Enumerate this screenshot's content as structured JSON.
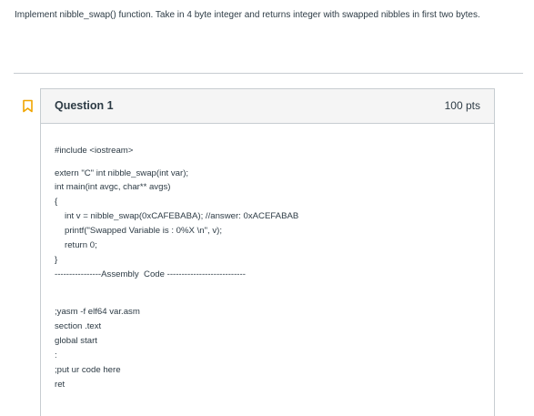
{
  "instructions": "Implement nibble_swap() function. Take in 4 byte integer and returns integer with swapped nibbles in first two bytes.",
  "colors": {
    "flag_accent": "#f0a500",
    "header_bg": "#f5f5f5",
    "border": "#c7cdd1",
    "text": "#2d3b45"
  },
  "question": {
    "title": "Question 1",
    "points": "100 pts",
    "flag_icon": "bookmark-flag-icon",
    "code_lines": [
      "#include <iostream>",
      "extern \"C\" int nibble_swap(int var);",
      "int main(int avgc, char** avgs)",
      "{",
      "int v = nibble_swap(0xCAFEBABA); //answer: 0xACEFABAB",
      "printf(\"Swapped Variable is : 0%X \\n\", v);",
      "return 0;",
      "}",
      "----------------Assembly  Code ---------------------------",
      ";yasm -f elf64 var.asm",
      "section .text",
      "global start",
      ":",
      ";put ur code here",
      "ret"
    ]
  }
}
